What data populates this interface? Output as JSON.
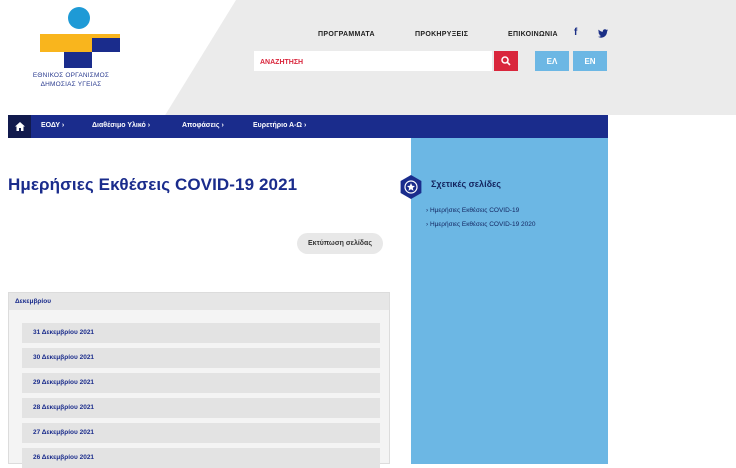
{
  "header": {
    "org_name_line1": "ΕΘΝΙΚΟΣ ΟΡΓΑΝΙΣΜΟΣ",
    "org_name_line2": "ΔΗΜΟΣΙΑΣ ΥΓΕΙΑΣ",
    "top_links": [
      "ΠΡΟΓΡΑΜΜΑΤΑ",
      "ΠΡΟΚΗΡΥΞΕΙΣ",
      "ΕΠΙΚΟΙΝΩΝΙΑ"
    ],
    "social_icons": [
      "facebook-icon",
      "twitter-icon"
    ],
    "search_placeholder": "ΑΝΑΖΗΤΗΣΗ",
    "lang_el": "ΕΛ",
    "lang_en": "EN"
  },
  "nav": {
    "items": [
      "ΕΟΔΥ ›",
      "Διαθέσιμο Υλικό ›",
      "Αποφάσεις ›",
      "Ευρετήριο Α-Ω ›"
    ]
  },
  "main": {
    "title": "Ημερήσιες Εκθέσεις COVID-19 2021",
    "print_button": "Εκτύπωση σελίδας",
    "accordion_header": "Δεκεμβρίου",
    "reports": [
      "31 Δεκεμβρίου 2021",
      "30 Δεκεμβρίου 2021",
      "29 Δεκεμβρίου 2021",
      "28 Δεκεμβρίου 2021",
      "27 Δεκεμβρίου 2021",
      "26 Δεκεμβρίου 2021"
    ]
  },
  "sidebar": {
    "title": "Σχετικές σελίδες",
    "links": [
      "› Ημερήσιες Εκθέσεις COVID-19",
      "› Ημερήσιες Εκθέσεις COVID-19 2020"
    ]
  },
  "colors": {
    "brand_blue": "#1a2c8c",
    "light_blue": "#6cb7e4",
    "red": "#d9263c",
    "yellow": "#f9b51d"
  }
}
